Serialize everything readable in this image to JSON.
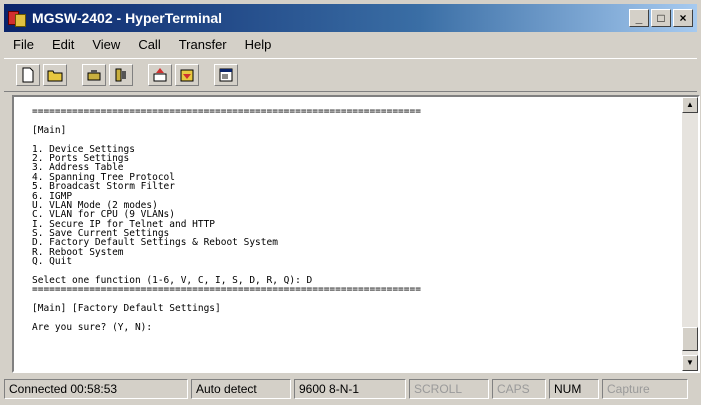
{
  "window": {
    "title": "MGSW-2402 - HyperTerminal"
  },
  "window_buttons": {
    "minimize": "_",
    "maximize": "□",
    "close": "×"
  },
  "menu": [
    "File",
    "Edit",
    "View",
    "Call",
    "Transfer",
    "Help"
  ],
  "toolbar": [
    "new-icon",
    "open-icon",
    "connect-icon",
    "disconnect-icon",
    "send-icon",
    "receive-icon",
    "properties-icon"
  ],
  "terminal": {
    "lines": [
      "====================================================================",
      "",
      "[Main]",
      "",
      "1. Device Settings",
      "2. Ports Settings",
      "3. Address Table",
      "4. Spanning Tree Protocol",
      "5. Broadcast Storm Filter",
      "6. IGMP",
      "U. VLAN Mode (2 modes)",
      "C. VLAN for CPU (9 VLANs)",
      "I. Secure IP for Telnet and HTTP",
      "S. Save Current Settings",
      "D. Factory Default Settings & Reboot System",
      "R. Reboot System",
      "Q. Quit",
      "",
      "Select one function (1-6, V, C, I, S, D, R, Q): D",
      "====================================================================",
      "",
      "[Main] [Factory Default Settings]",
      "",
      "Are you sure? (Y, N):"
    ]
  },
  "status": {
    "connected": "Connected 00:58:53",
    "detect": "Auto detect",
    "settings": "9600 8-N-1",
    "scroll": "SCROLL",
    "caps": "CAPS",
    "num": "NUM",
    "capture": "Capture"
  }
}
